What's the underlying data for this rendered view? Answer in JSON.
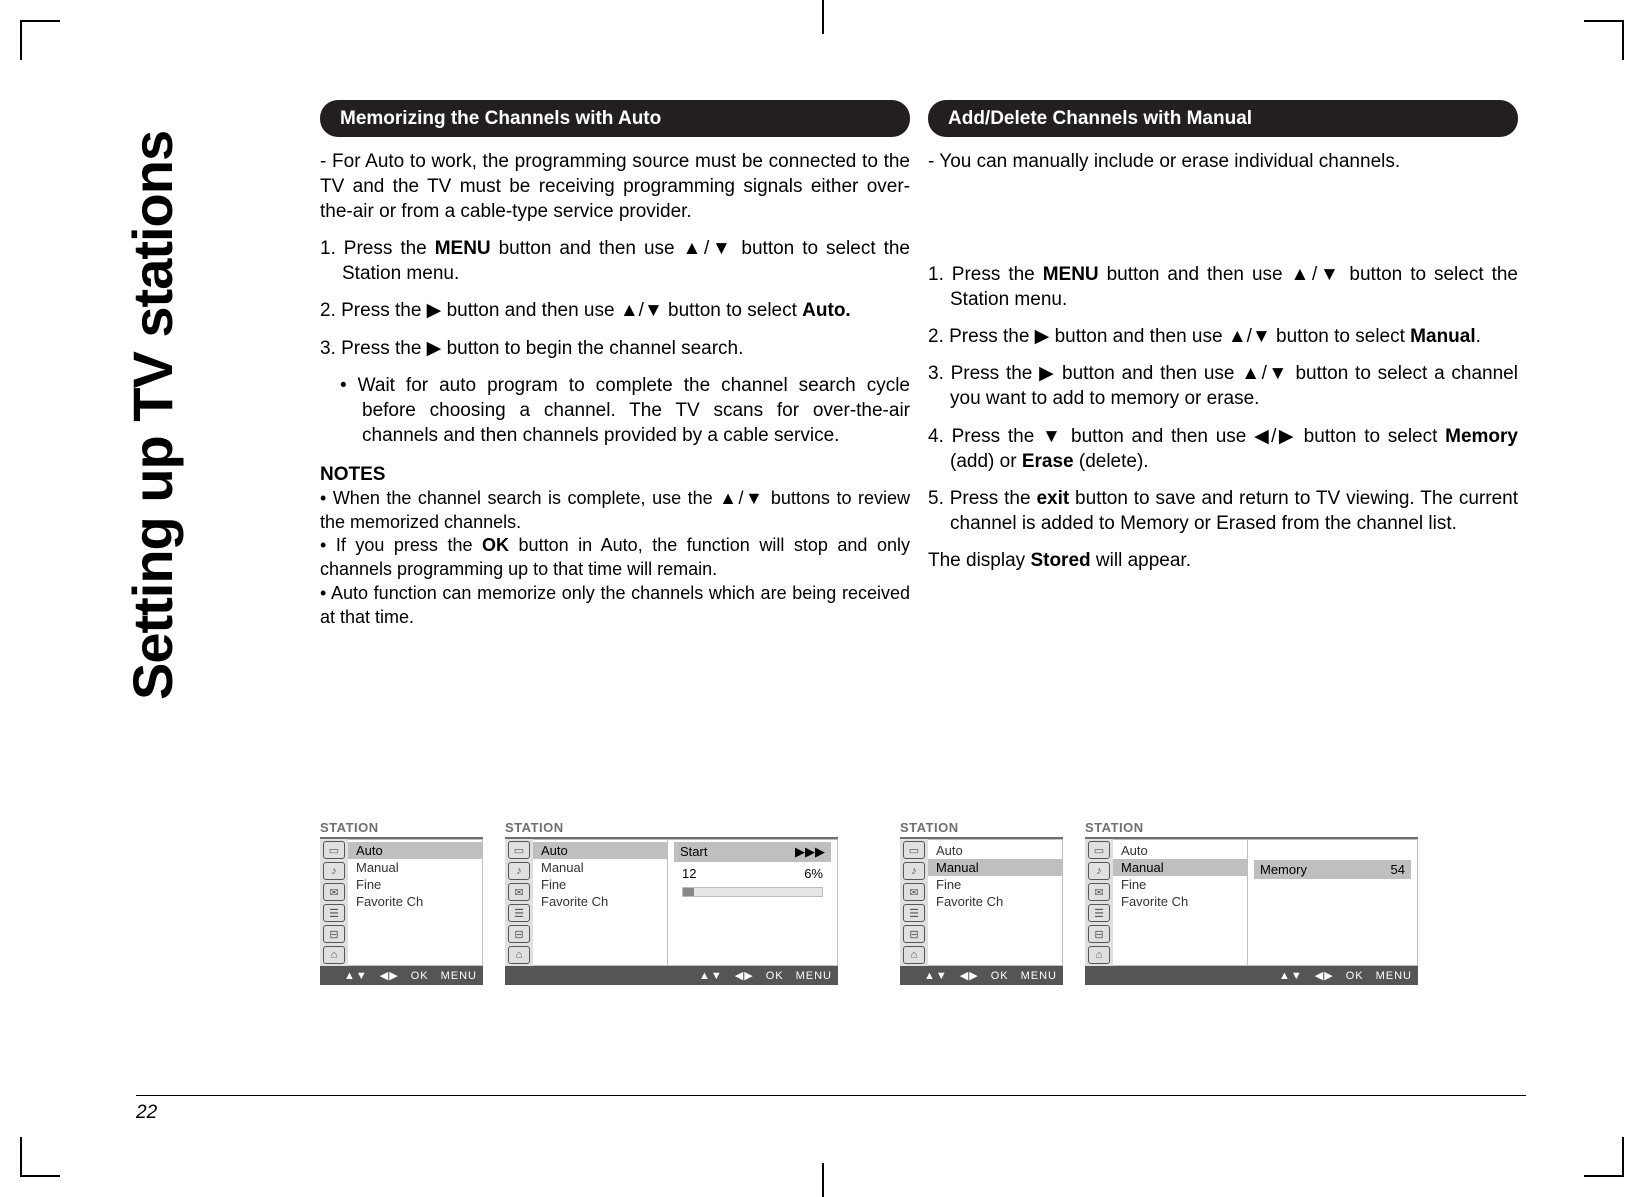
{
  "side_title": "Setting up TV stations",
  "page_number": "22",
  "glyphs": {
    "up": "▲",
    "down": "▼",
    "left": "◀",
    "right": "▶",
    "slash": "/",
    "triple_right": "▶▶▶"
  },
  "left": {
    "pill": "Memorizing the Channels with Auto",
    "intro": "- For Auto to work, the programming source must be connected to the TV and the TV must be receiving programming signals either over-the-air or from a cable-type service provider.",
    "s1a": "1. Press the ",
    "s1_menu": "MENU",
    "s1b": " button and then use ",
    "s1c": "  button to select the Station menu.",
    "s2a": "2. Press the ",
    "s2b": " button and then use ",
    "s2c": " button to select ",
    "s2_auto": "Auto.",
    "s3a": "3. Press the ",
    "s3b": " button to begin the channel search.",
    "s3bullet": "• Wait for auto program to complete the channel search cycle before choosing a channel. The TV scans for over-the-air channels and then channels provided by a cable service.",
    "notes_h": "NOTES",
    "n1a": "• When the channel search is complete, use the ",
    "n1b": " buttons to review the memorized channels.",
    "n2a": "• If you press the ",
    "n2_ok": "OK",
    "n2b": " button in Auto, the function will stop and only channels programming up to that time will remain.",
    "n3": "• Auto function can memorize only the channels which are being received at that time."
  },
  "right": {
    "pill": "Add/Delete Channels with Manual",
    "intro": "- You can manually include or erase individual channels.",
    "s1a": "1. Press the ",
    "s1_menu": "MENU",
    "s1b": " button and then use ",
    "s1c": "  button to select the Station menu.",
    "s2a": "2. Press the ",
    "s2b": " button and then use ",
    "s2c": " button to select ",
    "s2_manual": "Manual",
    "s2_dot": ".",
    "s3a": "3. Press the ",
    "s3b": " button and then use ",
    "s3c": " button to select a channel you want to add to memory or erase.",
    "s4a": "4. Press the ",
    "s4b": " button and then use ",
    "s4c": " button to select ",
    "s4_mem": "Memory",
    "s4_mid": " (add) or ",
    "s4_erase": "Erase",
    "s4_end": " (delete).",
    "s5a": "5. Press the ",
    "s5_exit": "exit",
    "s5b": " button to save and return to TV viewing. The current channel is added to Memory or Erased from the channel list.",
    "disp_a": "The display ",
    "disp_stored": "Stored",
    "disp_b": " will appear."
  },
  "osd": {
    "title": "STATION",
    "menu_items": [
      "Auto",
      "Manual",
      "Fine",
      "Favorite Ch"
    ],
    "footer_ok": "OK",
    "footer_menu": "MENU",
    "panel2": {
      "start": "Start",
      "num": "12",
      "pct": "6%"
    },
    "panel4": {
      "label": "Memory",
      "value": "54"
    }
  }
}
